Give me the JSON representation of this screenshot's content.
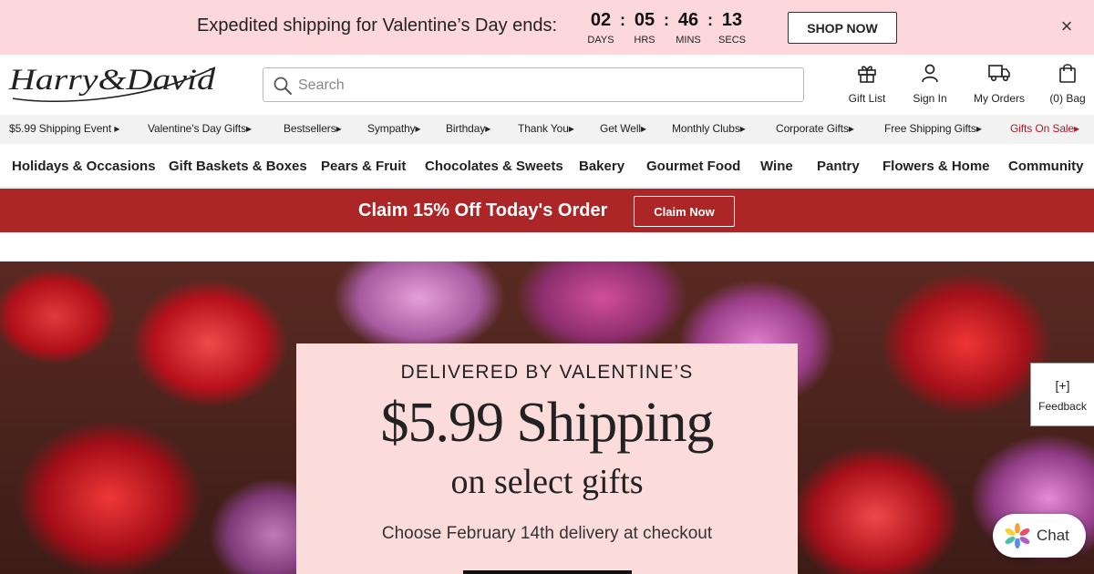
{
  "promo": {
    "text": "Expedited shipping for Valentine’s Day ends:",
    "countdown": [
      {
        "value": "02",
        "label": "DAYS"
      },
      {
        "value": "05",
        "label": "HRS"
      },
      {
        "value": "46",
        "label": "MINS"
      },
      {
        "value": "13",
        "label": "SECS"
      }
    ],
    "separator": ":",
    "button": "SHOP NOW",
    "close": "×"
  },
  "header": {
    "logo_text": "Harry&David",
    "search_placeholder": "Search",
    "items": {
      "gift_list": "Gift List",
      "sign_in": "Sign In",
      "my_orders": "My Orders",
      "bag": "(0) Bag"
    }
  },
  "subnav": [
    "$5.99 Shipping Event ▸",
    "Valentine's Day Gifts▸",
    "Bestsellers▸",
    "Sympathy▸",
    "Birthday▸",
    "Thank You▸",
    "Get Well▸",
    "Monthly Clubs▸",
    "Corporate Gifts▸",
    "Free Shipping Gifts▸",
    "Gifts On Sale▸"
  ],
  "mainnav": [
    "Holidays & Occasions",
    "Gift Baskets & Boxes",
    "Pears & Fruit",
    "Chocolates & Sweets",
    "Bakery",
    "Gourmet Food",
    "Wine",
    "Pantry",
    "Flowers & Home",
    "Community"
  ],
  "claim": {
    "text": "Claim 15% Off Today's Order",
    "button": "Claim Now"
  },
  "hero": {
    "eyebrow": "DELIVERED BY VALENTINE’S",
    "headline": "$5.99 Shipping",
    "sub": "on select gifts",
    "desc": "Choose February 14th delivery at checkout"
  },
  "feedback": {
    "icon": "[+]",
    "label": "Feedback"
  },
  "chat": {
    "label": "Chat"
  },
  "colors": {
    "promo_bg": "#fcd8dc",
    "claim_bg": "#ac2527",
    "sale_link": "#b0182a",
    "hero_card_bg": "#fcdcdb"
  }
}
